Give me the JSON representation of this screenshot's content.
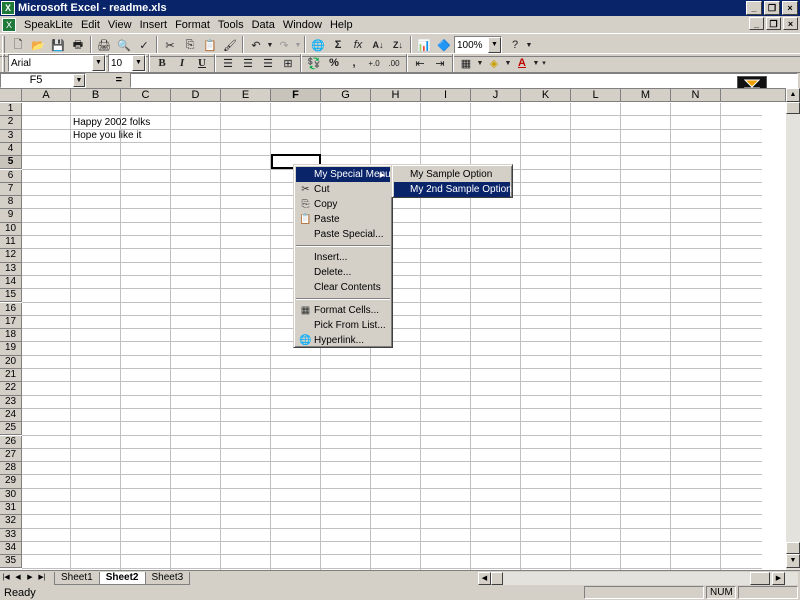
{
  "window": {
    "title": "Microsoft Excel - readme.xls"
  },
  "menubar": {
    "items": [
      "SpeakLite",
      "Edit",
      "View",
      "Insert",
      "Format",
      "Tools",
      "Data",
      "Window",
      "Help"
    ]
  },
  "toolbar_standard": {
    "zoom": "100%"
  },
  "toolbar_format": {
    "font": "Arial",
    "size": "10"
  },
  "formula_bar": {
    "name_box": "F5",
    "equals": "="
  },
  "grid": {
    "columns": [
      "A",
      "B",
      "C",
      "D",
      "E",
      "F",
      "G",
      "H",
      "I",
      "J",
      "K",
      "L",
      "M",
      "N"
    ],
    "rows": [
      "1",
      "2",
      "3",
      "4",
      "5",
      "6",
      "7",
      "8",
      "9",
      "10",
      "11",
      "12",
      "13",
      "14",
      "15",
      "16",
      "17",
      "18",
      "19",
      "20",
      "21",
      "22",
      "23",
      "24",
      "25",
      "26",
      "27",
      "28",
      "29",
      "30",
      "31",
      "32",
      "33",
      "34",
      "35"
    ],
    "active_cell": "F5",
    "cells": {
      "B2": "Happy 2002 folks",
      "B3": "Hope you like it"
    }
  },
  "context_menu": {
    "items": [
      "My Special Menu",
      "Cut",
      "Copy",
      "Paste",
      "Paste Special...",
      "Insert...",
      "Delete...",
      "Clear Contents",
      "Format Cells...",
      "Pick From List...",
      "Hyperlink..."
    ],
    "submenu": [
      "My Sample Option",
      "My 2nd Sample Option"
    ]
  },
  "sheets": {
    "tabs": [
      "Sheet1",
      "Sheet2",
      "Sheet3"
    ],
    "active": "Sheet2"
  },
  "statusbar": {
    "left": "Ready",
    "num": "NUM"
  },
  "colors": {
    "titlebar": "#0a246a",
    "face": "#d4d0c8",
    "highlight": "#0a246a"
  }
}
